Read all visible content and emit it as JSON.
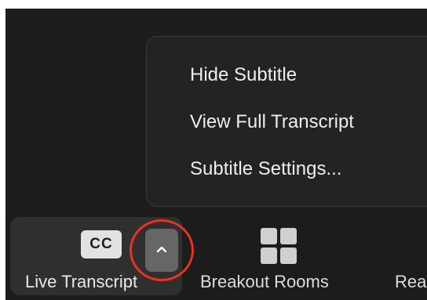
{
  "menu": {
    "items": [
      {
        "label": "Hide Subtitle"
      },
      {
        "label": "View Full Transcript"
      },
      {
        "label": "Subtitle Settings..."
      }
    ]
  },
  "toolbar": {
    "live_transcript": {
      "icon_text": "CC",
      "label": "Live Transcript",
      "icon": "closed-captions-icon"
    },
    "options_chevron": {
      "icon": "chevron-up-icon"
    },
    "breakout_rooms": {
      "label": "Breakout Rooms",
      "icon": "grid-icon"
    },
    "reactions": {
      "label": "Rea"
    }
  },
  "colors": {
    "background": "#1d1d1d",
    "menu_background": "#232323",
    "highlight_ring": "#e9321d",
    "chevron_button": "#666666",
    "active_button": "#2f2f2f"
  }
}
